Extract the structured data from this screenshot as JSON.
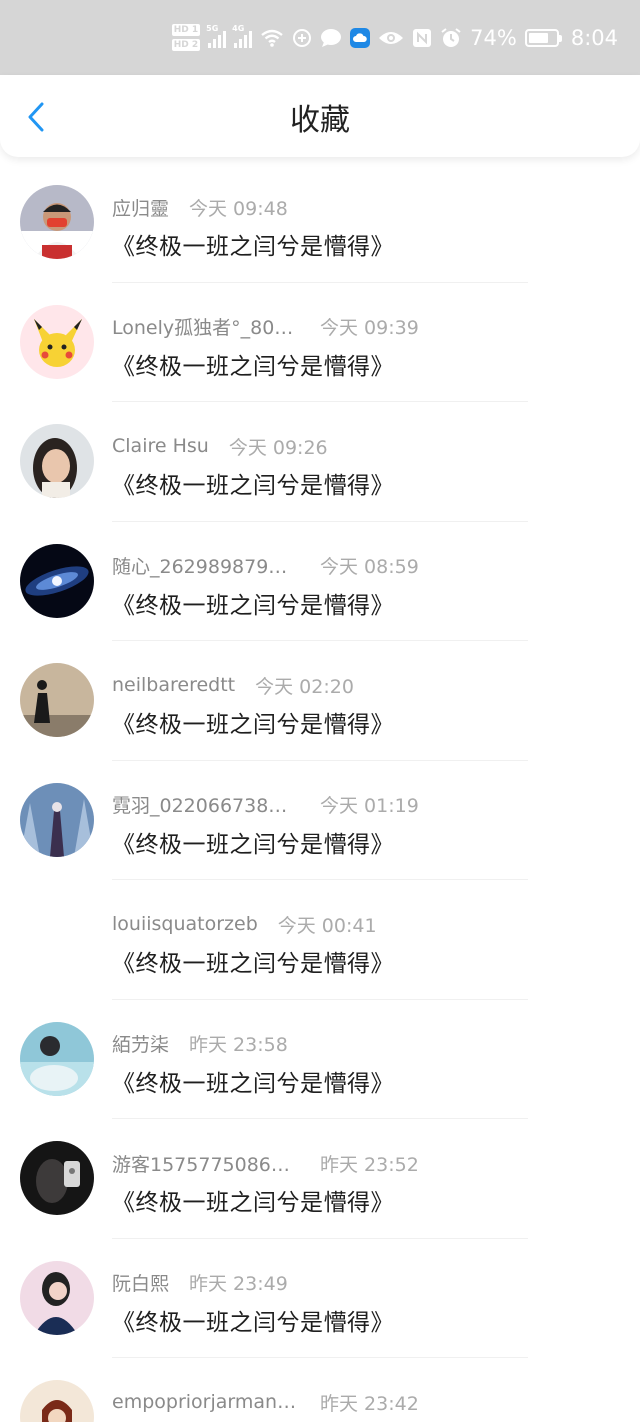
{
  "status_bar": {
    "hd_tags": [
      "HD 1",
      "HD 2"
    ],
    "network_labels": [
      "5G",
      "4G"
    ],
    "battery_percent": "74%",
    "battery_level": 0.74,
    "time": "8:04",
    "icons": [
      "wifi-icon",
      "vpn-icon",
      "message-icon",
      "cloud-app-icon",
      "eye-icon",
      "nfc-icon",
      "alarm-icon",
      "battery-icon"
    ]
  },
  "header": {
    "title": "收藏",
    "back_icon": "chevron-left-icon",
    "accent_color": "#2196f3"
  },
  "items": [
    {
      "username": "应归靈",
      "time": "今天 09:48",
      "title": "《终极一班之闫兮是懵得》",
      "avatar": "red-mask-avatar"
    },
    {
      "username": "Lonely孤独者°_80…",
      "time": "今天 09:39",
      "title": "《终极一班之闫兮是懵得》",
      "avatar": "pikachu-avatar"
    },
    {
      "username": "Claire Hsu",
      "time": "今天 09:26",
      "title": "《终极一班之闫兮是懵得》",
      "avatar": "girl-photo-avatar"
    },
    {
      "username": "随心_262989879…",
      "time": "今天 08:59",
      "title": "《终极一班之闫兮是懵得》",
      "avatar": "galaxy-avatar"
    },
    {
      "username": "neilbareredtt",
      "time": "今天 02:20",
      "title": "《终极一班之闫兮是懵得》",
      "avatar": "silhouette-avatar"
    },
    {
      "username": "霓羽_022066738…",
      "time": "今天 01:19",
      "title": "《终极一班之闫兮是懵得》",
      "avatar": "snow-forest-avatar"
    },
    {
      "username": "louiisquatorzeb",
      "time": "今天 00:41",
      "title": "《终极一班之闫兮是懵得》",
      "avatar": "none"
    },
    {
      "username": "絔芀柒",
      "time": "昨天 23:58",
      "title": "《终极一班之闫兮是懵得》",
      "avatar": "water-girl-avatar"
    },
    {
      "username": "游客1575775086…",
      "time": "昨天 23:52",
      "title": "《终极一班之闫兮是懵得》",
      "avatar": "dark-selfie-avatar"
    },
    {
      "username": "阮白熙",
      "time": "昨天 23:49",
      "title": "《终极一班之闫兮是懵得》",
      "avatar": "pink-girl-avatar"
    },
    {
      "username": "empopriorjarman…",
      "time": "昨天 23:42",
      "title": "",
      "avatar": "illustration-avatar"
    }
  ]
}
